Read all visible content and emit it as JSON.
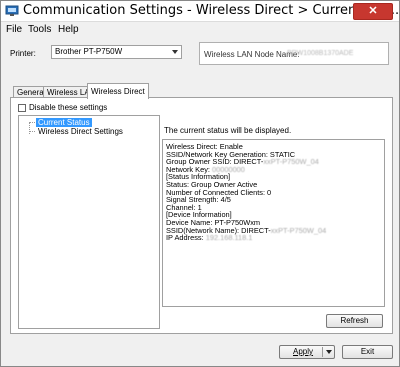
{
  "window": {
    "title": "Communication Settings - Wireless Direct > Current Sta...",
    "close_glyph": "✕"
  },
  "menu": [
    "File",
    "Tools",
    "Help"
  ],
  "printer": {
    "label": "Printer:",
    "selected": "Brother PT-P750W"
  },
  "node": {
    "label": "Wireless LAN Node Name:",
    "value": "BRW1008B1370ADE"
  },
  "tabs": [
    {
      "label": "General"
    },
    {
      "label": "Wireless LAN"
    },
    {
      "label": "Wireless Direct"
    }
  ],
  "disable_checkbox": {
    "label": "Disable these settings",
    "checked": false
  },
  "tree": [
    {
      "label": "Current Status",
      "selected": true
    },
    {
      "label": "Wireless Direct Settings",
      "selected": false
    }
  ],
  "status": {
    "caption": "The current status will be displayed.",
    "lines": [
      {
        "text": "Wireless Direct: Enable"
      },
      {
        "text": "SSID/Network Key Generation: STATIC"
      },
      {
        "text": "Group Owner SSID: DIRECT-",
        "blur": "xxPT-P750W_04"
      },
      {
        "text": "Network Key: ",
        "blur": "00000000"
      },
      {
        "text": "[Status Information]"
      },
      {
        "text": "Status: Group Owner Active"
      },
      {
        "text": "Number of Connected Clients: 0"
      },
      {
        "text": "Signal Strength: 4/5"
      },
      {
        "text": "Channel: 1"
      },
      {
        "text": "[Device Information]"
      },
      {
        "text": "Device Name: PT-P750Wxm"
      },
      {
        "text": "SSID(Network Name): DIRECT-",
        "blur": "xxPT-P750W_04"
      },
      {
        "text": "IP Address: ",
        "blur": "192.168.118.1"
      }
    ]
  },
  "buttons": {
    "refresh": "Refresh",
    "apply": "Apply",
    "exit": "Exit"
  }
}
